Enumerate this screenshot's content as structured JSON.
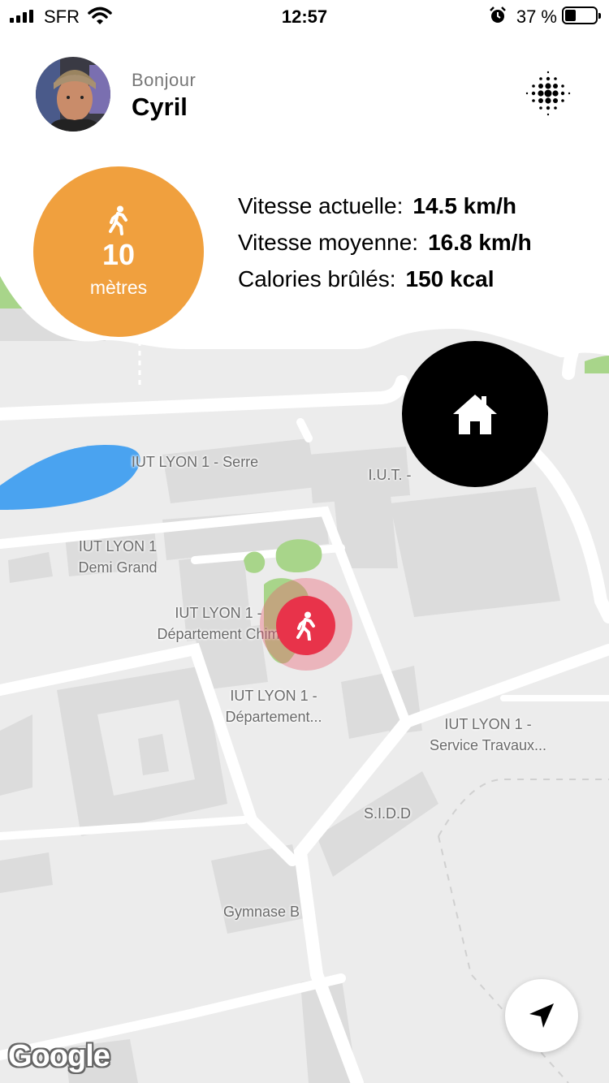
{
  "status_bar": {
    "carrier": "SFR",
    "time": "12:57",
    "battery_percent": "37 %",
    "battery_level": 0.37
  },
  "profile": {
    "greeting": "Bonjour",
    "name": "Cyril"
  },
  "activity": {
    "distance_value": "10",
    "distance_unit": "mètres",
    "stats": [
      {
        "label": "Vitesse actuelle:",
        "value": "14.5 km/h"
      },
      {
        "label": "Vitesse moyenne:",
        "value": "16.8 km/h"
      },
      {
        "label": "Calories brûlés:",
        "value": "150 kcal"
      }
    ]
  },
  "map": {
    "labels": [
      {
        "text": "IUT LYON 1 - Serre"
      },
      {
        "text": "I.U.T. -"
      },
      {
        "text": "IUT LYON 1\nDemi Grand"
      },
      {
        "text": "IUT LYON 1 -\nDépartement Chim"
      },
      {
        "text": "IUT LYON 1 -\nDépartement..."
      },
      {
        "text": "IUT LYON 1 -\nService Travaux..."
      },
      {
        "text": "S.I.D.D"
      },
      {
        "text": "Gymnase B"
      }
    ],
    "attribution": "Google"
  },
  "icons": {
    "accent_orange": "#f0a03e",
    "marker_red": "#e8334a",
    "home_button_bg": "#000000"
  }
}
